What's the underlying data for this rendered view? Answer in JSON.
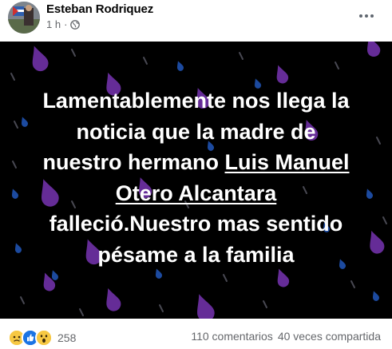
{
  "post": {
    "author": "Esteban Rodriquez",
    "time": "1 h",
    "separator": "·",
    "privacy_icon": "globe-icon",
    "more_icon": "more-dots-icon"
  },
  "image": {
    "background": "#000000",
    "drop_color": "#6b2fa0",
    "text_line1": "Lamentablemente nos llega la",
    "text_line2": "noticia que la madre de",
    "text_line3_pre": "nuestro hermano ",
    "name_part1": "Luis Manuel",
    "name_part2": "Otero Alcantara",
    "text_line5": "falleció.Nuestro mas sentido",
    "text_line6": "pésame a la familia"
  },
  "footer": {
    "reaction_icons": [
      "sad-reaction-icon",
      "like-reaction-icon",
      "wow-reaction-icon"
    ],
    "reaction_count": "258",
    "comments": "110 comentarios",
    "shares": "40 veces compartida"
  }
}
